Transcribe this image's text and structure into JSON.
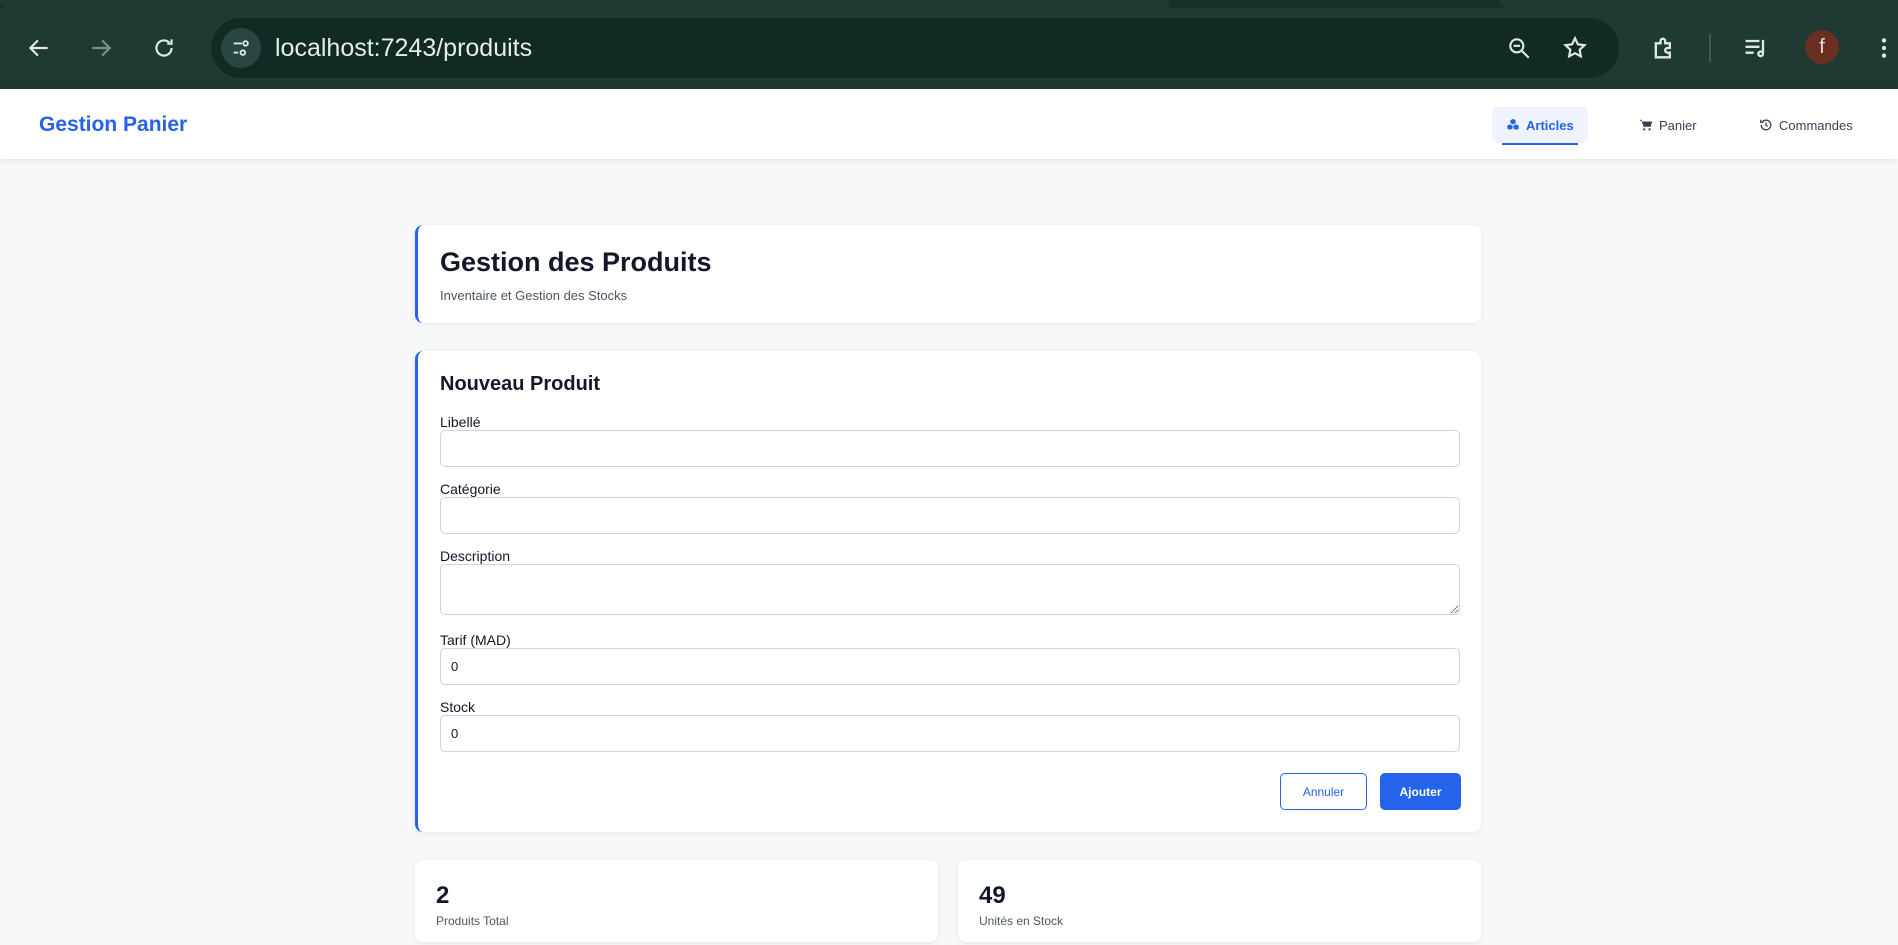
{
  "browser": {
    "url_host": "localhost",
    "url_rest": ":7243/produits",
    "avatar_initial": "f",
    "icons": [
      "back-icon",
      "forward-icon",
      "reload-icon",
      "site-info-icon",
      "zoom-out-icon",
      "star-icon",
      "extensions-icon",
      "media-icon",
      "menu-icon"
    ]
  },
  "app": {
    "brand": "Gestion Panier",
    "nav": [
      {
        "label": "Articles",
        "icon": "cubes-icon",
        "active": true
      },
      {
        "label": "Panier",
        "icon": "cart-icon",
        "active": false
      },
      {
        "label": "Commandes",
        "icon": "history-icon",
        "active": false
      }
    ]
  },
  "page": {
    "title": "Gestion des Produits",
    "subtitle": "Inventaire et Gestion des Stocks"
  },
  "form": {
    "title": "Nouveau Produit",
    "fields": {
      "libelle": {
        "label": "Libellé",
        "value": ""
      },
      "categorie": {
        "label": "Catégorie",
        "value": ""
      },
      "description": {
        "label": "Description",
        "value": ""
      },
      "tarif": {
        "label": "Tarif (MAD)",
        "value": "0"
      },
      "stock": {
        "label": "Stock",
        "value": "0"
      }
    },
    "cancel_label": "Annuler",
    "submit_label": "Ajouter"
  },
  "stats": [
    {
      "value": "2",
      "label": "Produits Total"
    },
    {
      "value": "49",
      "label": "Unités en Stock"
    }
  ],
  "colors": {
    "accent": "#2563eb",
    "chrome": "#1e3a33"
  }
}
